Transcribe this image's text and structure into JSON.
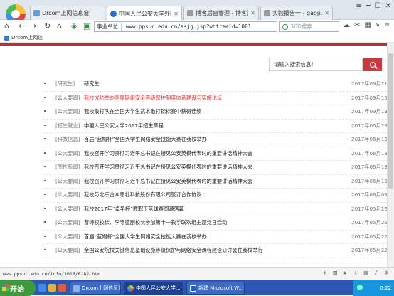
{
  "browser": {
    "tabs": [
      {
        "label": "Drcom上网信息窗",
        "active": false
      },
      {
        "label": "中国人民公安大学外网",
        "active": true
      },
      {
        "label": "博客后台管理 - 博客园",
        "active": false
      },
      {
        "label": "实验报告一 - gaojiuggu",
        "active": false
      }
    ],
    "address_badge": "事业单位",
    "url": "www.ppsuc.edu.cn/ssjg.jsp?wbtreeid=1001",
    "search_placeholder": "360搜索",
    "bookmark": "Drcom上网信"
  },
  "page": {
    "search_placeholder": "请输入搜索信息!",
    "news": [
      {
        "cat": "[研究生]",
        "title": "研究生",
        "date": "2017年09月21日",
        "hl": false
      },
      {
        "cat": "[公大要闻]",
        "title": "我校成功举办国家网络安全等级保护制度体系建设与实施论坛",
        "date": "2017年09月15日",
        "hl": true
      },
      {
        "cat": "[公大要闻]",
        "title": "我校散打队在全国大学生武术散打锦标赛中获得佳绩",
        "date": "2017年09月13日",
        "hl": false
      },
      {
        "cat": "[招生就业]",
        "title": "中国人民公安大学2017年招生章程",
        "date": "2017年06月29日",
        "hl": false
      },
      {
        "cat": "[科教信息]",
        "title": "首届“蓝帽杯”全国大学生网络安全技能大赛在我校举办",
        "date": "2017年06月13日",
        "hl": false
      },
      {
        "cat": "[公大要闻]",
        "title": "我校召开学习贯彻习近平总书记在接见公安英模代表时的重要讲话精神大会",
        "date": "2017年06月13日",
        "hl": false
      },
      {
        "cat": "[图片新闻]",
        "title": "我校召开学习贯彻习近平总书记在接见公安英模代表时的重要讲话精神大会",
        "date": "2017年06月13日",
        "hl": false
      },
      {
        "cat": "[公大要闻]",
        "title": "我校召开学习贯彻习近平总书记在接见公安英模代表时的重要讲话精神大会",
        "date": "2017年06月13日",
        "hl": false
      },
      {
        "cat": "[公大要闻]",
        "title": "我校与北京合众思壮科技股份有限公司签订合作协议",
        "date": "2017年06月09日",
        "hl": false
      },
      {
        "cat": "[公大要闻]",
        "title": "我校2017年“卓早杯”教职工篮球赛圆满落幕",
        "date": "2017年05月26日",
        "hl": false
      },
      {
        "cat": "[公大要闻]",
        "title": "曹诗权校长、李守德副校长参加第十一教学联欢组主题党日活动",
        "date": "2017年05月25日",
        "hl": false
      },
      {
        "cat": "[公大要闻]",
        "title": "首届“蓝帽杯”全国大学生网络安全技能大赛在我校举办",
        "date": "2017年05月22日",
        "hl": false
      },
      {
        "cat": "[公大要闻]",
        "title": "全国公安院校关键信息基础设施等级保护与网络安全课程建设研讨会在我校举行",
        "date": "2017年05月22日",
        "hl": false
      }
    ]
  },
  "status": {
    "url": "www.ppsuc.edu.cn/info/1016/6182.htm"
  },
  "taskbar": {
    "start": "开始",
    "tasks": [
      {
        "label": "Drcom上网信息窗",
        "active": false
      },
      {
        "label": "中国人民公安大学...",
        "active": true
      },
      {
        "label": "新建 Microsoft W...",
        "active": false
      }
    ],
    "time": "0:22"
  },
  "colors": {
    "accent": "#c83a3f",
    "highlight": "#dd3333",
    "taskbar": "#2b56b3"
  }
}
